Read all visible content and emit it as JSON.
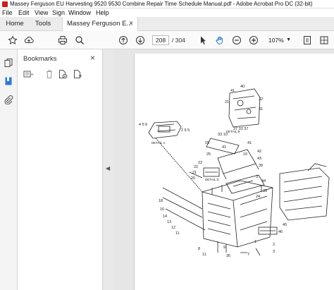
{
  "window": {
    "title": "Massey Ferguson EU Harvesting 9520 9530 Combine Repair Time Schedule Manual.pdf - Adobe Acrobat Pro DC (32-bit)"
  },
  "menu": [
    "File",
    "Edit",
    "View",
    "Sign",
    "Window",
    "Help"
  ],
  "tabs": {
    "home": "Home",
    "tools": "Tools",
    "document": "Massey Ferguson E...",
    "document_close": "×"
  },
  "toolbar": {
    "current_page": "208",
    "page_total": "/ 304",
    "zoom": "107%",
    "icons": [
      "star-icon",
      "upload-icon",
      "print-icon",
      "search-icon",
      "page-up-icon",
      "page-down-icon",
      "select-arrow-icon",
      "hand-icon",
      "zoom-out-icon",
      "zoom-in-icon",
      "fit-page-icon",
      "scroll-mode-icon",
      "comment-icon",
      "highlight-icon"
    ]
  },
  "left_rail": {
    "icons": [
      "copy-pages-icon",
      "bookmark-icon",
      "attachment-icon"
    ]
  },
  "bookmarks_panel": {
    "title": "Bookmarks",
    "close": "×",
    "tool_icons": [
      "options-menu-icon",
      "delete-icon",
      "new-bookmark-icon",
      "expand-bookmark-icon"
    ]
  },
  "document": {
    "diagram_labels": [
      "4",
      "5",
      "6",
      "40",
      "21",
      "22",
      "24",
      "25",
      "26",
      "27",
      "28",
      "32",
      "33",
      "34",
      "35",
      "36",
      "37",
      "38",
      "39",
      "41",
      "42",
      "43",
      "44",
      "45",
      "23",
      "20",
      "10",
      "18",
      "16",
      "14",
      "13",
      "12",
      "11",
      "8",
      "9",
      "7",
      "2",
      "3",
      "1",
      "46",
      "DETAIL B",
      "DETAIL C",
      "DETAIL D"
    ]
  },
  "colors": {
    "accent": "#2b7ad3",
    "title_bar": "#ffffff",
    "tab_bar": "#ececec",
    "panel_bg": "#ffffff",
    "doc_bg": "#e6e6e6"
  }
}
